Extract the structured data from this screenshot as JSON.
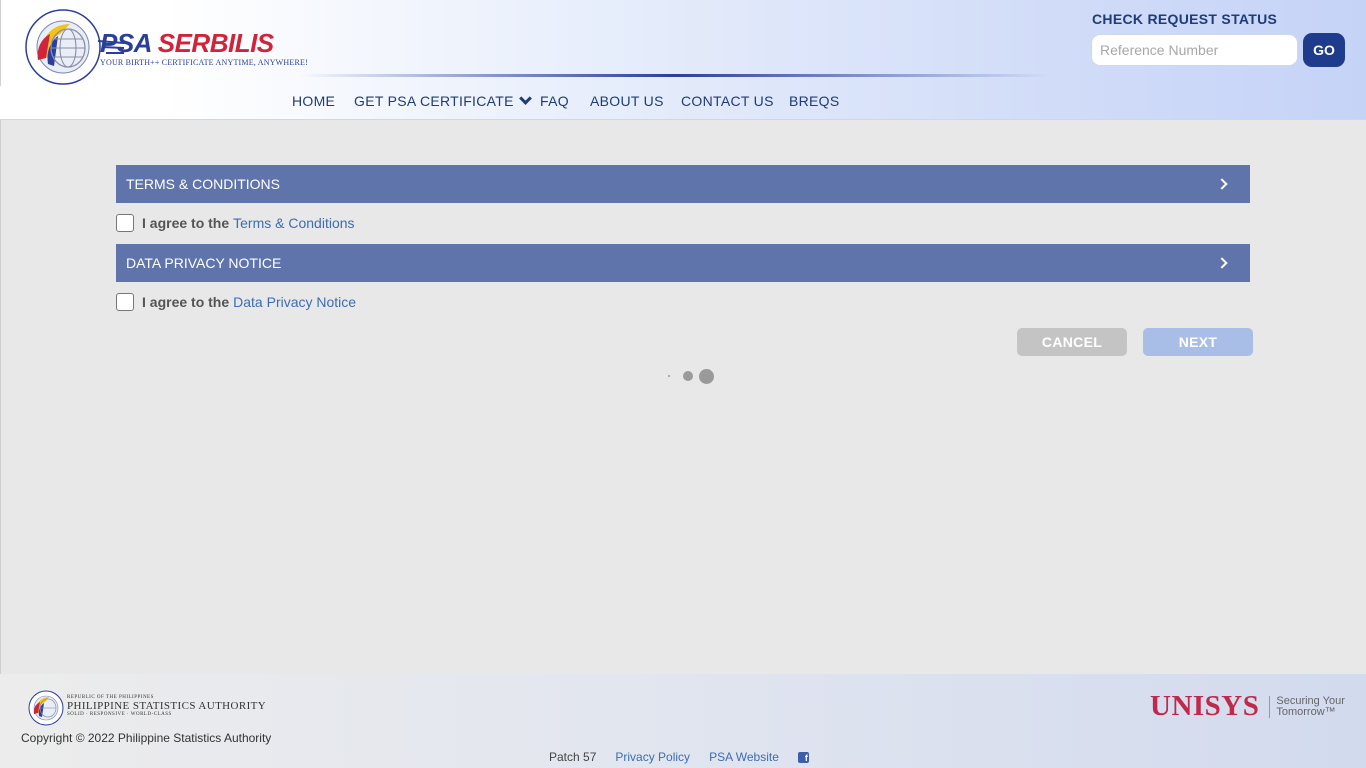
{
  "brand": {
    "name_part1": "PSA",
    "name_part2": "SERBILIS",
    "tagline": "YOUR BIRTH++ CERTIFICATE ANYTIME, ANYWHERE!"
  },
  "nav": {
    "items": [
      {
        "label": "HOME"
      },
      {
        "label": "GET PSA CERTIFICATE"
      },
      {
        "label": "FAQ"
      },
      {
        "label": "ABOUT US"
      },
      {
        "label": "CONTACT US"
      },
      {
        "label": "BREQS"
      }
    ]
  },
  "status": {
    "title": "CHECK REQUEST STATUS",
    "placeholder": "Reference Number",
    "value": "",
    "go_label": "GO"
  },
  "sections": {
    "terms": {
      "header": "TERMS & CONDITIONS",
      "agree_prefix": "I agree to the",
      "agree_link": "Terms & Conditions",
      "checked": false
    },
    "privacy": {
      "header": "DATA PRIVACY NOTICE",
      "agree_prefix": "I agree to the",
      "agree_link": "Data Privacy Notice",
      "checked": false
    }
  },
  "actions": {
    "cancel_label": "CANCEL",
    "next_label": "NEXT"
  },
  "footer": {
    "psa_republic": "REPUBLIC OF THE PHILIPPINES",
    "psa_name": "PHILIPPINE STATISTICS AUTHORITY",
    "psa_motto": "SOLID · RESPONSIVE · WORLD-CLASS",
    "copyright": "Copyright © 2022 Philippine Statistics Authority",
    "patch": "Patch 57",
    "privacy_policy": "Privacy Policy",
    "psa_website": "PSA Website",
    "unisys": "UNISYS",
    "unisys_tag1": "Securing Your",
    "unisys_tag2": "Tomorrow™"
  },
  "colors": {
    "accent": "#5f74aa",
    "nav_text": "#1f3b78",
    "brand_blue": "#2a3f9a",
    "brand_red": "#d0243a",
    "link": "#3d6db3",
    "unisys_red": "#c0294a"
  },
  "icons": {
    "nav_dropdown": "chevron-down-icon",
    "section_expand": "chevron-right-icon",
    "loading": "loading-dots-icon",
    "social": "facebook-icon"
  }
}
